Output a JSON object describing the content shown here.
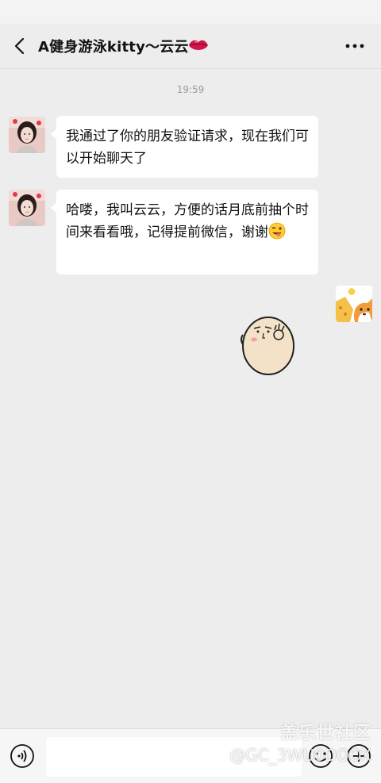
{
  "header": {
    "title": "A健身游泳kitty～云云",
    "title_emoji": "lips-icon"
  },
  "conversation": {
    "timestamp": "19:59",
    "messages": [
      {
        "sender": "contact",
        "text": "我通过了你的朋友验证请求，现在我们可以开始聊天了"
      },
      {
        "sender": "contact",
        "text": "哈喽，我叫云云，方便的话月底前抽个时间来看看哦，记得提前微信，谢谢",
        "trailing_emoji": "wink-tongue-emoji"
      },
      {
        "sender": "self",
        "type": "sticker",
        "sticker": "egg-ok-sticker"
      }
    ]
  },
  "input_bar": {
    "placeholder": ""
  },
  "watermark": {
    "line1": "盖乐世社区",
    "line2": "@GC_3WU0DOOX"
  },
  "colors": {
    "background": "#ededed",
    "bubble": "#ffffff",
    "header": "#ededed"
  }
}
